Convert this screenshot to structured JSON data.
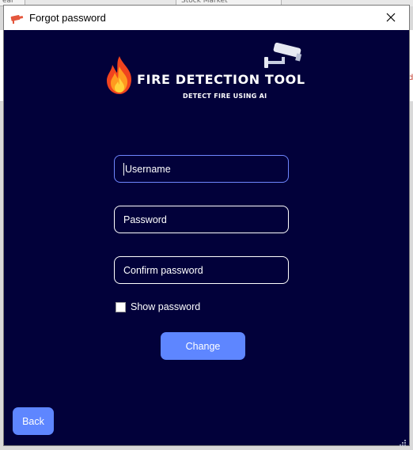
{
  "background_app": {
    "tabs": [
      "ear",
      "Stock Market"
    ],
    "right_edge_char": "d"
  },
  "window": {
    "title": "Forgot password",
    "app_icon": "camera-icon",
    "close_icon": "close-icon"
  },
  "brand": {
    "title": "FIRE DETECTION TOOL",
    "subtitle": "DETECT FIRE USING AI",
    "logo_icons": [
      "flame-icon",
      "security-camera-icon"
    ]
  },
  "form": {
    "username_placeholder": "Username",
    "password_placeholder": "Password",
    "confirm_placeholder": "Confirm password",
    "show_password_label": "Show password",
    "show_password_checked": false,
    "change_label": "Change",
    "back_label": "Back"
  },
  "colors": {
    "background": "#02013a",
    "accent": "#5e86ff",
    "focus_border": "#6f86ff",
    "titlebar": "#ffffff"
  }
}
